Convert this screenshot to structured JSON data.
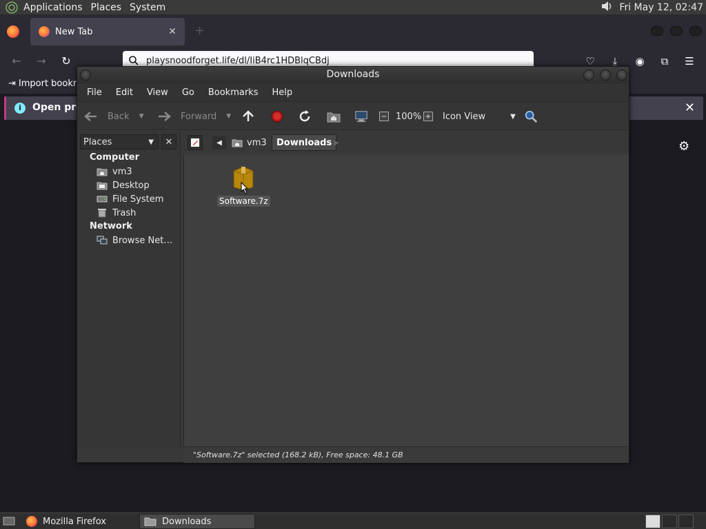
{
  "top_panel": {
    "menus": [
      "Applications",
      "Places",
      "System"
    ],
    "clock": "Fri May 12, 02:47"
  },
  "firefox": {
    "tab_label": "New Tab",
    "url": "playsnoodforget.life/dl/IiB4rc1HDBlqCBdj",
    "bookmark_import": "Import bookm",
    "notice_text": "Open previ"
  },
  "file_manager": {
    "title": "Downloads",
    "menus": [
      "File",
      "Edit",
      "View",
      "Go",
      "Bookmarks",
      "Help"
    ],
    "toolbar": {
      "back": "Back",
      "forward": "Forward",
      "zoom": "100%",
      "view_mode": "Icon View"
    },
    "sidebar": {
      "selector": "Places",
      "sections": [
        {
          "heading": "Computer",
          "items": [
            "vm3",
            "Desktop",
            "File System",
            "Trash"
          ]
        },
        {
          "heading": "Network",
          "items": [
            "Browse Net…"
          ]
        }
      ]
    },
    "breadcrumbs": [
      "vm3",
      "Downloads"
    ],
    "files": [
      {
        "name": "Software.7z"
      }
    ],
    "status": "\"Software.7z\" selected (168.2 kB), Free space: 48.1 GB"
  },
  "taskbar": {
    "tasks": [
      "Mozilla Firefox",
      "Downloads"
    ]
  }
}
